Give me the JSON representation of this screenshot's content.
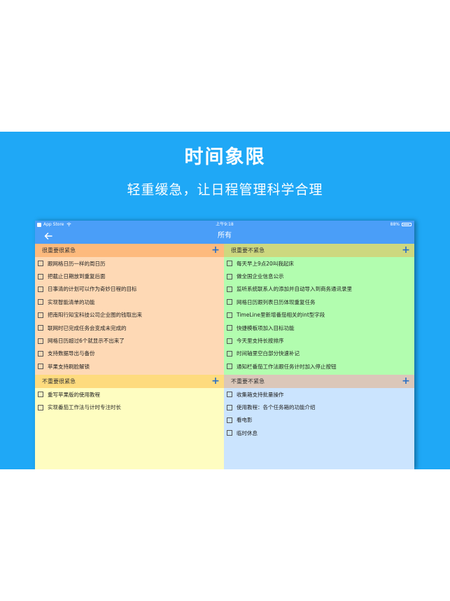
{
  "banner": {
    "title": "时间象限",
    "subtitle": "轻重缓急，让日程管理科学合理",
    "background": "#1fa8f6"
  },
  "status_bar": {
    "carrier": "App Store",
    "time": "上午9:18",
    "battery": "88%",
    "battery_level": 0.88
  },
  "nav": {
    "back_icon": "back-arrow-icon",
    "title": "所有"
  },
  "quadrants": [
    {
      "id": "important-urgent",
      "label": "很重要很紧急",
      "header_color": "#fdba7d",
      "body_color": "#fed9b5",
      "tasks": [
        "跟网格日历一样的周日历",
        "把截止日期放到重复后面",
        "日事清的计划可以作为奇妙日程的目标",
        "实现智能清单的功能",
        "把南阳行知宝科技公司企业图的钱取出来",
        "联网时已完成任务会变成未完成的",
        "网格日历超过6个就显示不出来了",
        "支持数据导出与备份",
        "苹果支持刷脸解锁"
      ]
    },
    {
      "id": "important-not-urgent",
      "label": "很重要不紧急",
      "header_color": "#cdd87f",
      "body_color": "#b2fdaf",
      "tasks": [
        "每天早上9点20叫我起床",
        "做全国企业信息公示",
        "监听系统联系人的添加并自动导入到商务通讯录里",
        "网格日历跟列表日历体现重复任务",
        "TimeLine里新增番茄相关的int型字段",
        "快捷模板项加入目标功能",
        "今天里支持长按排序",
        "时间轴里空白部分快速补记",
        "通知栏番茄工作法跟任务计时加入停止按钮"
      ]
    },
    {
      "id": "not-important-urgent",
      "label": "不重要很紧急",
      "header_color": "#fedb7e",
      "body_color": "#fefdc1",
      "tasks": [
        "重写苹果版的使用教程",
        "实现番茄工作法与计时专注时长"
      ]
    },
    {
      "id": "not-important-not-urgent",
      "label": "不重要不紧急",
      "header_color": "#dbc7b9",
      "body_color": "#cbe4fe",
      "tasks": [
        "收集箱支持批量操作",
        "使用教程：各个任务箱的功能介绍",
        "看电影",
        "临时休息"
      ]
    }
  ],
  "add_icon": "plus-icon"
}
